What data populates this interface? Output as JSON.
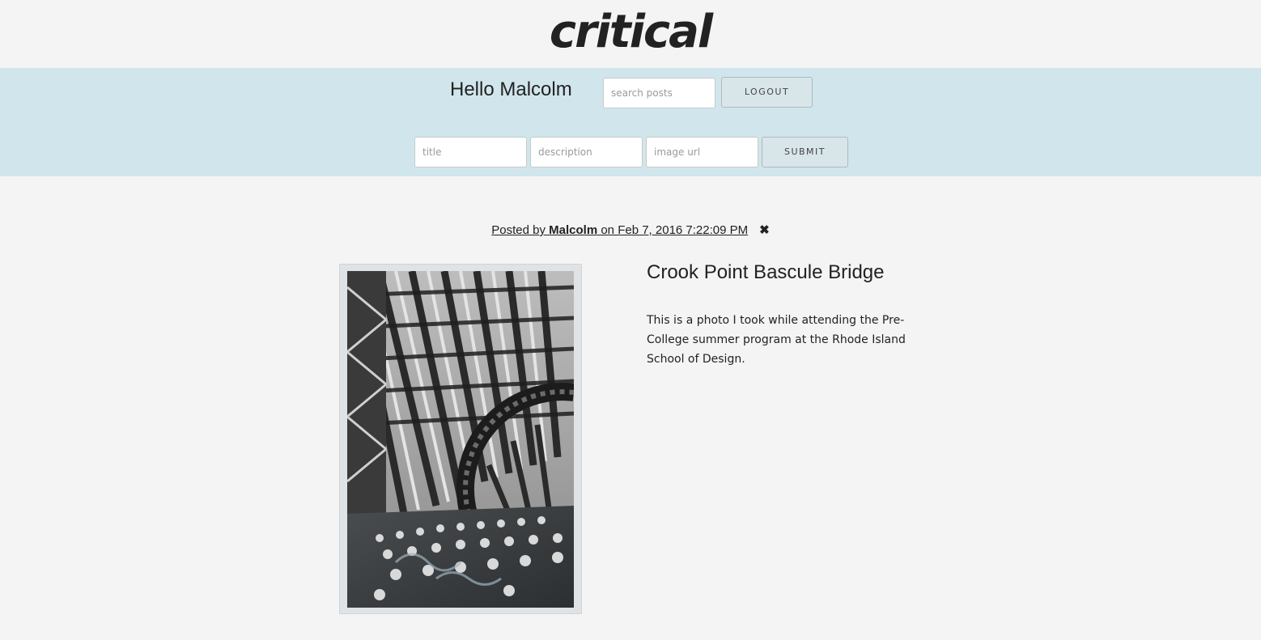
{
  "header": {
    "logo_text": "critical"
  },
  "nav": {
    "greeting": "Hello Malcolm",
    "search_placeholder": "search posts",
    "logout_label": "LOGOUT"
  },
  "new_post_form": {
    "title_placeholder": "title",
    "description_placeholder": "description",
    "image_url_placeholder": "image url",
    "submit_label": "SUBMIT"
  },
  "post": {
    "posted_by_prefix": "Posted by ",
    "author": "Malcolm",
    "date_text": " on Feb 7, 2016 7:22:09 PM",
    "delete_icon": "close-icon",
    "title": "Crook Point Bascule Bridge",
    "description": "This is a photo I took while attending the Pre-College summer program at the Rhode Island School of Design.",
    "image_subject": "black and white photo of steel bridge girders and gear"
  },
  "colors": {
    "page_bg": "#f4f4f4",
    "nav_bg": "#d0e6ec",
    "button_bg": "#d8e6ea"
  }
}
